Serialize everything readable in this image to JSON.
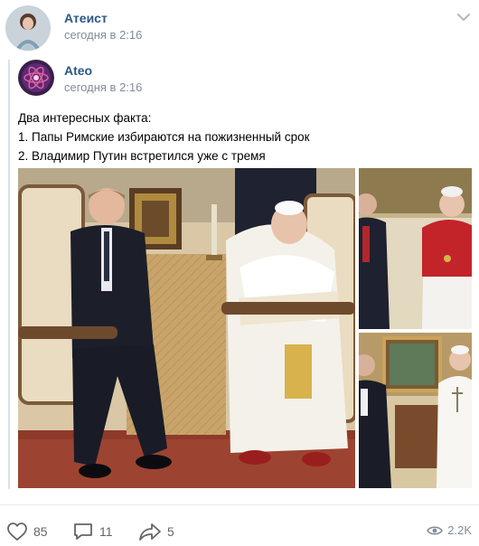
{
  "post": {
    "author": {
      "name": "Атеист",
      "time": "сегодня в 2:16"
    },
    "repost": {
      "author": {
        "name": "Ateo",
        "time": "сегодня в 2:16"
      },
      "text": {
        "line1": "Два интересных факта:",
        "line2": "1. Папы Римские избираются на пожизненный срок",
        "line3": "2. Владимир Путин встретился уже с тремя"
      },
      "photos": [
        {
          "icon": "photo-putin-pope-john-paul"
        },
        {
          "icon": "photo-putin-pope-benedict"
        },
        {
          "icon": "photo-putin-pope-francis"
        }
      ]
    },
    "actions": {
      "likes": "85",
      "comments": "11",
      "shares": "5",
      "views": "2.2K"
    },
    "colors": {
      "link": "#2a5885",
      "meta": "#818c99",
      "icon": "#656565"
    }
  }
}
